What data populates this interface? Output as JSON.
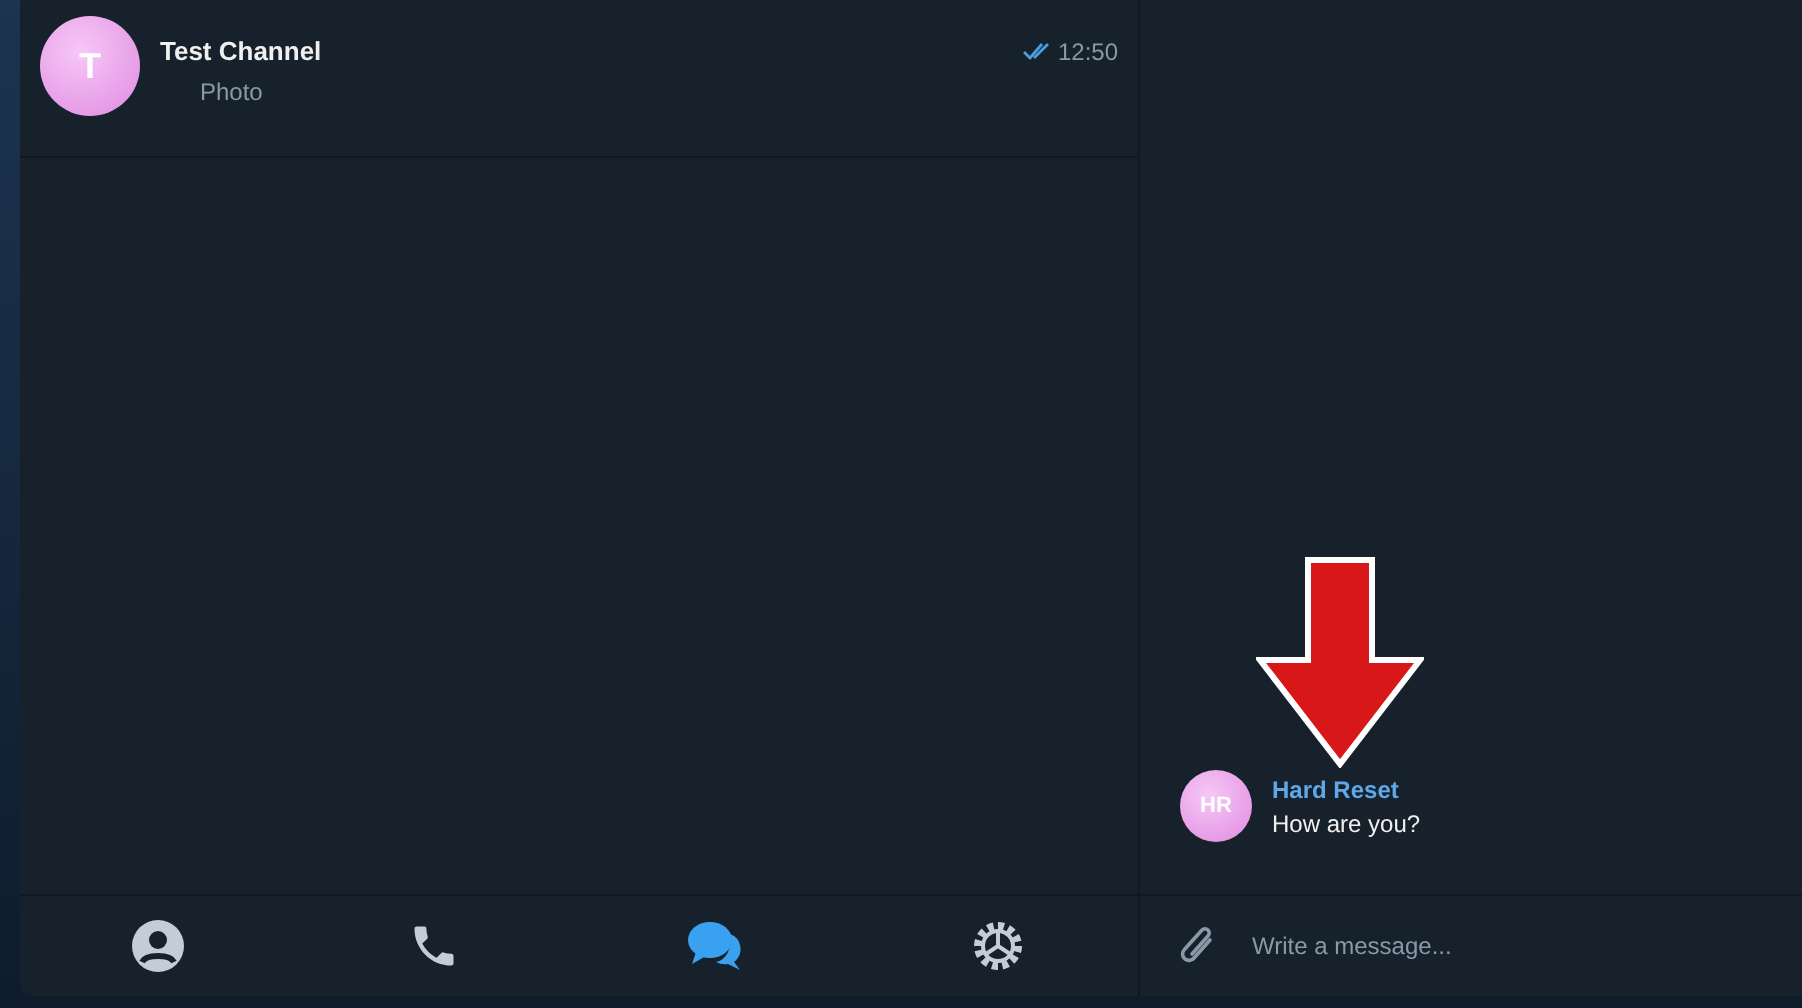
{
  "chats": [
    {
      "initials": "T",
      "name": "Test Channel",
      "preview": "Photo",
      "time": "12:50",
      "read": true,
      "selected": false
    }
  ],
  "tabs": [
    {
      "kind": "contacts",
      "selected": false
    },
    {
      "kind": "calls",
      "selected": false
    },
    {
      "kind": "chats",
      "selected": true
    },
    {
      "kind": "settings",
      "selected": false
    }
  ],
  "messages": [
    {
      "initials": "HR",
      "sender": "Hard Reset",
      "text": "How are you?"
    }
  ],
  "composer": {
    "placeholder": "Write a message..."
  },
  "annotation": {
    "kind": "arrow"
  }
}
